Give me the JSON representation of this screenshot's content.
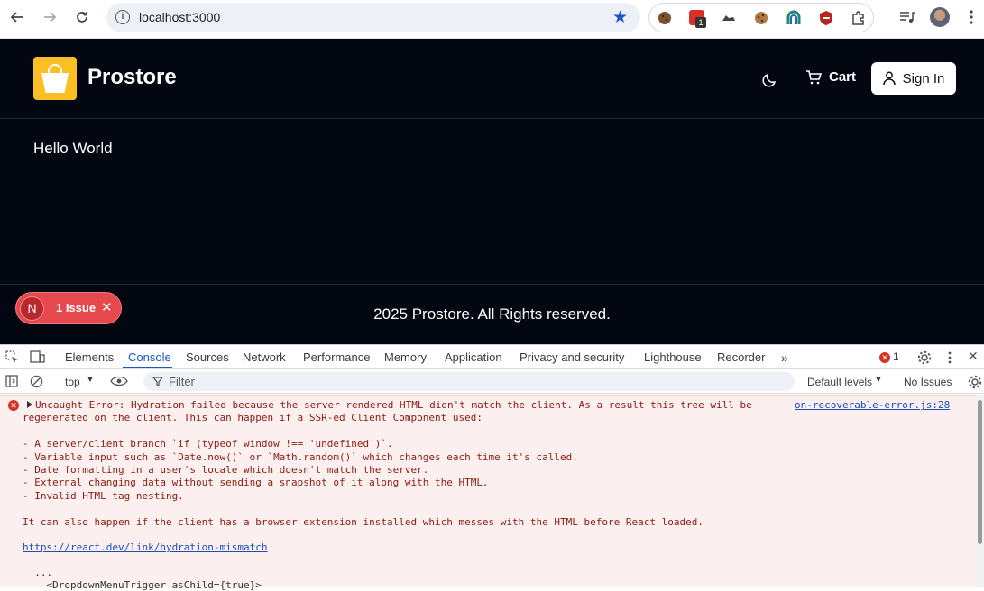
{
  "browser": {
    "url": "localhost:3000",
    "extension_badge": "1"
  },
  "site": {
    "brand": "Prostore",
    "cart_label": "Cart",
    "signin_label": "Sign In",
    "hello": "Hello World",
    "footer": "2025 Prostore. All Rights reserved.",
    "issue_letter": "N",
    "issue_label": "1 Issue",
    "colors": {
      "background": "#030712",
      "logo": "#fbbf24",
      "issue": "#e5484d"
    }
  },
  "devtools": {
    "tabs": [
      "Elements",
      "Console",
      "Sources",
      "Network",
      "Performance",
      "Memory",
      "Application",
      "Privacy and security",
      "Lighthouse",
      "Recorder"
    ],
    "active_tab": "Console",
    "error_count": "1",
    "context": "top",
    "filter_placeholder": "Filter",
    "levels": "Default levels",
    "issues": "No Issues",
    "source_link": "on-recoverable-error.js:28",
    "error_lines": [
      "Uncaught Error: Hydration failed because the server rendered HTML didn't match the client. As a result this tree will be",
      "regenerated on the client. This can happen if a SSR-ed Client Component used:",
      "",
      "- A server/client branch `if (typeof window !== 'undefined')`.",
      "- Variable input such as `Date.now()` or `Math.random()` which changes each time it's called.",
      "- Date formatting in a user's locale which doesn't match the server.",
      "- External changing data without sending a snapshot of it along with the HTML.",
      "- Invalid HTML tag nesting.",
      "",
      "It can also happen if the client has a browser extension installed which messes with the HTML before React loaded."
    ],
    "doc_link": "https://react.dev/link/hydration-mismatch",
    "trace_lines": [
      "  ...",
      "    <DropdownMenuTrigger asChild={true}>"
    ]
  }
}
